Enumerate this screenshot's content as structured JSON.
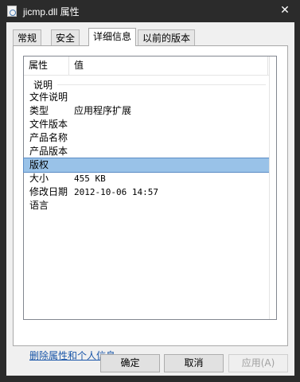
{
  "window": {
    "title": "jicmp.dll 属性",
    "icon": "dll-file-icon",
    "close_symbol": "✕"
  },
  "tabs": [
    {
      "label": "常规"
    },
    {
      "label": "安全"
    },
    {
      "label": "详细信息",
      "active": true
    },
    {
      "label": "以前的版本"
    }
  ],
  "details": {
    "columns": [
      "属性",
      "值"
    ],
    "group_label": "说明",
    "rows": [
      {
        "key": "文件说明",
        "value": ""
      },
      {
        "key": "类型",
        "value": "应用程序扩展"
      },
      {
        "key": "文件版本",
        "value": ""
      },
      {
        "key": "产品名称",
        "value": ""
      },
      {
        "key": "产品版本",
        "value": ""
      },
      {
        "key": "版权",
        "value": "",
        "selected": true
      },
      {
        "key": "大小",
        "value": "455 KB"
      },
      {
        "key": "修改日期",
        "value": "2012-10-06 14:57"
      },
      {
        "key": "语言",
        "value": ""
      }
    ]
  },
  "remove_link": "删除属性和个人信息",
  "buttons": {
    "ok": "确定",
    "cancel": "取消",
    "apply": "应用(A)"
  },
  "colors": {
    "selection": "#99c2e8",
    "link": "#1a56a8",
    "titlebar": "#2b2b2b"
  }
}
